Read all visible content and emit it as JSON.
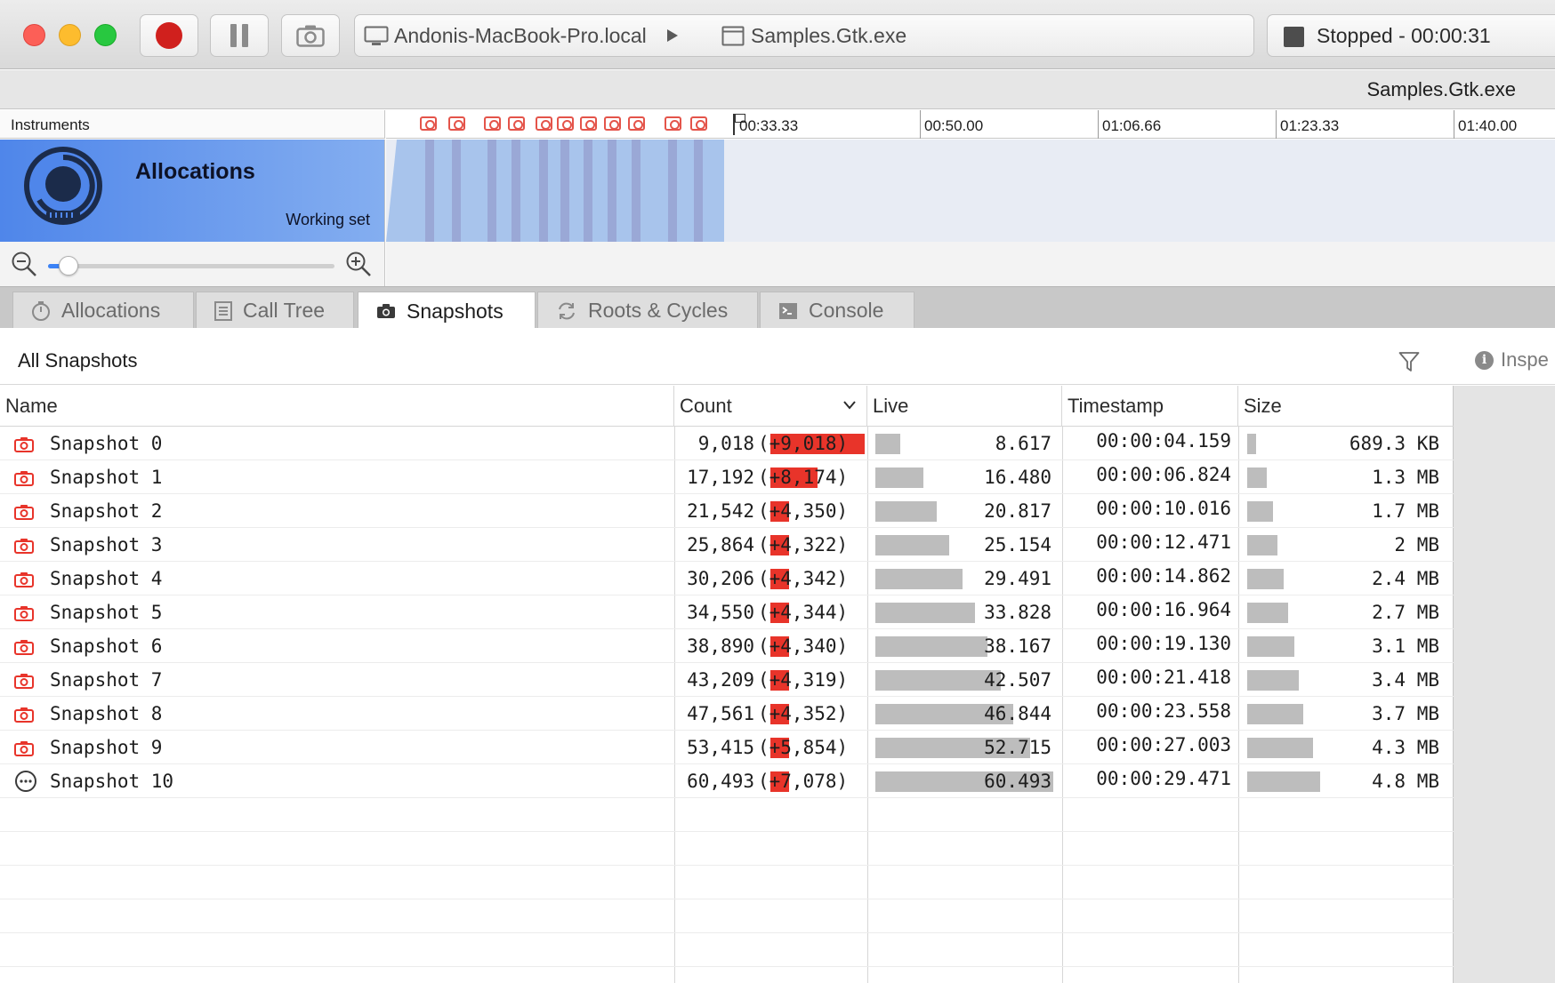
{
  "window": {
    "device": "Andonis-MacBook-Pro.local",
    "target": "Samples.Gtk.exe",
    "status": "Stopped - 00:00:31",
    "subtitle": "Samples.Gtk.exe"
  },
  "colors": {
    "accent": "#3b82f6",
    "record": "#d0201d",
    "delta_bar": "#e8342a",
    "gray_bar": "#bdbdbd",
    "track_blue": "#5a8ded"
  },
  "instruments": {
    "header": "Instruments",
    "ticks": [
      "00:33.33",
      "00:50.00",
      "01:06.66",
      "01:23.33",
      "01:40.00"
    ],
    "track": {
      "title": "Allocations",
      "subtitle": "Working set",
      "icon": "gauge-icon"
    },
    "zoom_level": 0.07
  },
  "tabs": [
    {
      "label": "Allocations",
      "icon": "stopwatch-icon",
      "active": false
    },
    {
      "label": "Call Tree",
      "icon": "call-tree-icon",
      "active": false
    },
    {
      "label": "Snapshots",
      "icon": "camera-icon",
      "active": true
    },
    {
      "label": "Roots & Cycles",
      "icon": "cycle-icon",
      "active": false
    },
    {
      "label": "Console",
      "icon": "console-icon",
      "active": false
    }
  ],
  "panel": {
    "title": "All Snapshots",
    "inspect_label": "Inspe"
  },
  "table": {
    "columns": [
      "Name",
      "Count",
      "Live",
      "Timestamp",
      "Size"
    ],
    "sort_column": "Count",
    "rows": [
      {
        "name": "Snapshot 0",
        "count": "9,018",
        "delta": "+9,018",
        "delta_frac": 1.0,
        "live": "8.617",
        "timestamp": "00:00:04.159",
        "size": "689.3 KB",
        "size_frac": 0.12,
        "state": "camera"
      },
      {
        "name": "Snapshot 1",
        "count": "17,192",
        "delta": "+8,174",
        "delta_frac": 0.5,
        "live": "16.480",
        "timestamp": "00:00:06.824",
        "size": "1.3 MB",
        "size_frac": 0.27,
        "state": "camera"
      },
      {
        "name": "Snapshot 2",
        "count": "21,542",
        "delta": "+4,350",
        "delta_frac": 0.2,
        "live": "20.817",
        "timestamp": "00:00:10.016",
        "size": "1.7 MB",
        "size_frac": 0.35,
        "state": "camera"
      },
      {
        "name": "Snapshot 3",
        "count": "25,864",
        "delta": "+4,322",
        "delta_frac": 0.2,
        "live": "25.154",
        "timestamp": "00:00:12.471",
        "size": "2 MB",
        "size_frac": 0.42,
        "state": "camera"
      },
      {
        "name": "Snapshot 4",
        "count": "30,206",
        "delta": "+4,342",
        "delta_frac": 0.2,
        "live": "29.491",
        "timestamp": "00:00:14.862",
        "size": "2.4 MB",
        "size_frac": 0.5,
        "state": "camera"
      },
      {
        "name": "Snapshot 5",
        "count": "34,550",
        "delta": "+4,344",
        "delta_frac": 0.2,
        "live": "33.828",
        "timestamp": "00:00:16.964",
        "size": "2.7 MB",
        "size_frac": 0.56,
        "state": "camera"
      },
      {
        "name": "Snapshot 6",
        "count": "38,890",
        "delta": "+4,340",
        "delta_frac": 0.2,
        "live": "38.167",
        "timestamp": "00:00:19.130",
        "size": "3.1 MB",
        "size_frac": 0.65,
        "state": "camera"
      },
      {
        "name": "Snapshot 7",
        "count": "43,209",
        "delta": "+4,319",
        "delta_frac": 0.2,
        "live": "42.507",
        "timestamp": "00:00:21.418",
        "size": "3.4 MB",
        "size_frac": 0.71,
        "state": "camera"
      },
      {
        "name": "Snapshot 8",
        "count": "47,561",
        "delta": "+4,352",
        "delta_frac": 0.2,
        "live": "46.844",
        "timestamp": "00:00:23.558",
        "size": "3.7 MB",
        "size_frac": 0.77,
        "state": "camera"
      },
      {
        "name": "Snapshot 9",
        "count": "53,415",
        "delta": "+5,854",
        "delta_frac": 0.2,
        "live": "52.715",
        "timestamp": "00:00:27.003",
        "size": "4.3 MB",
        "size_frac": 0.9,
        "state": "camera"
      },
      {
        "name": "Snapshot 10",
        "count": "60,493",
        "delta": "+7,078",
        "delta_frac": 0.2,
        "live": "60.493",
        "timestamp": "00:00:29.471",
        "size": "4.8 MB",
        "size_frac": 1.0,
        "state": "pending"
      }
    ]
  }
}
